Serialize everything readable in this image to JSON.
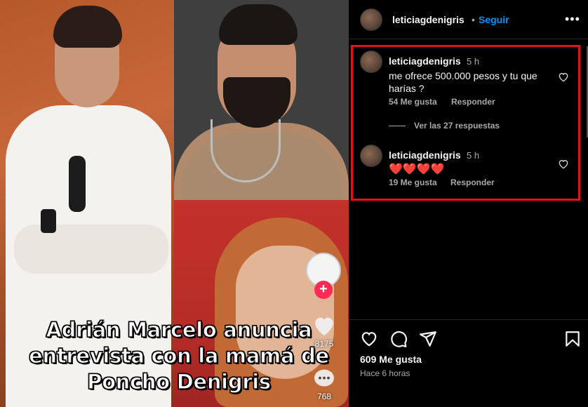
{
  "post": {
    "caption_line1": "Adrián Marcelo anuncia",
    "caption_line2": "entrevista con la mamá de",
    "caption_line3": "Poncho Denigris",
    "tiktok_likes": "8175",
    "tiktok_comments": "768"
  },
  "header": {
    "username": "leticiagdenigris",
    "separator": "•",
    "follow_label": "Seguir",
    "more_label": "•••"
  },
  "comments": [
    {
      "username": "leticiagdenigris",
      "time": "5 h",
      "text": "me ofrece 500.000 pesos y tu que harías ?",
      "likes": "54 Me gusta",
      "reply_label": "Responder"
    },
    {
      "username": "leticiagdenigris",
      "time": "5 h",
      "text": "❤️❤️❤️❤️",
      "likes": "19 Me gusta",
      "reply_label": "Responder"
    }
  ],
  "view_replies_label": "Ver las 27 respuestas",
  "actions": {
    "likes_count": "609 Me gusta",
    "post_time": "Hace 6 horas",
    "icons": [
      "heart-icon",
      "comment-icon",
      "share-icon",
      "save-icon"
    ]
  },
  "colors": {
    "follow_blue": "#0095f6",
    "highlight_red": "#e0131c",
    "tiktok_red": "#fe2c55",
    "background": "#000000"
  }
}
